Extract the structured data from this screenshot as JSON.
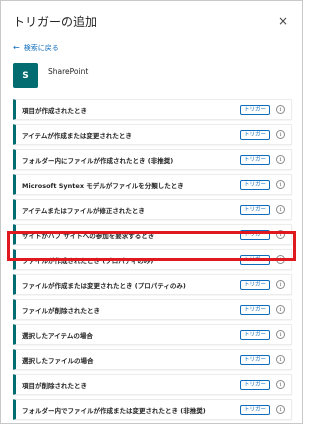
{
  "panel": {
    "title": "トリガーの追加",
    "close_icon": "×"
  },
  "back": {
    "label": "検索に戻る"
  },
  "connector": {
    "name": "SharePoint",
    "logo_letter": "S"
  },
  "badge_label": "トリガー",
  "info_glyph": "i",
  "triggers": [
    {
      "label": "項目が作成されたとき"
    },
    {
      "label": "アイテムが作成または変更されたとき"
    },
    {
      "label": "フォルダー内にファイルが作成されたとき (非推奨)"
    },
    {
      "label": "Microsoft Syntex モデルがファイルを分類したとき"
    },
    {
      "label": "アイテムまたはファイルが修正されたとき"
    },
    {
      "label": "サイトがハブ サイトへの参加を要求するとき"
    },
    {
      "label": "ファイルが作成されたとき (プロパティのみ)"
    },
    {
      "label": "ファイルが作成または変更されたとき (プロパティのみ)"
    },
    {
      "label": "ファイルが削除されたとき"
    },
    {
      "label": "選択したアイテムの場合"
    },
    {
      "label": "選択したファイルの場合"
    },
    {
      "label": "項目が削除されたとき"
    },
    {
      "label": "フォルダー内でファイルが作成または変更されたとき (非推奨)"
    }
  ],
  "colors": {
    "accent": "#036c70",
    "link": "#0f6cbd",
    "highlight": "#e0181f"
  }
}
